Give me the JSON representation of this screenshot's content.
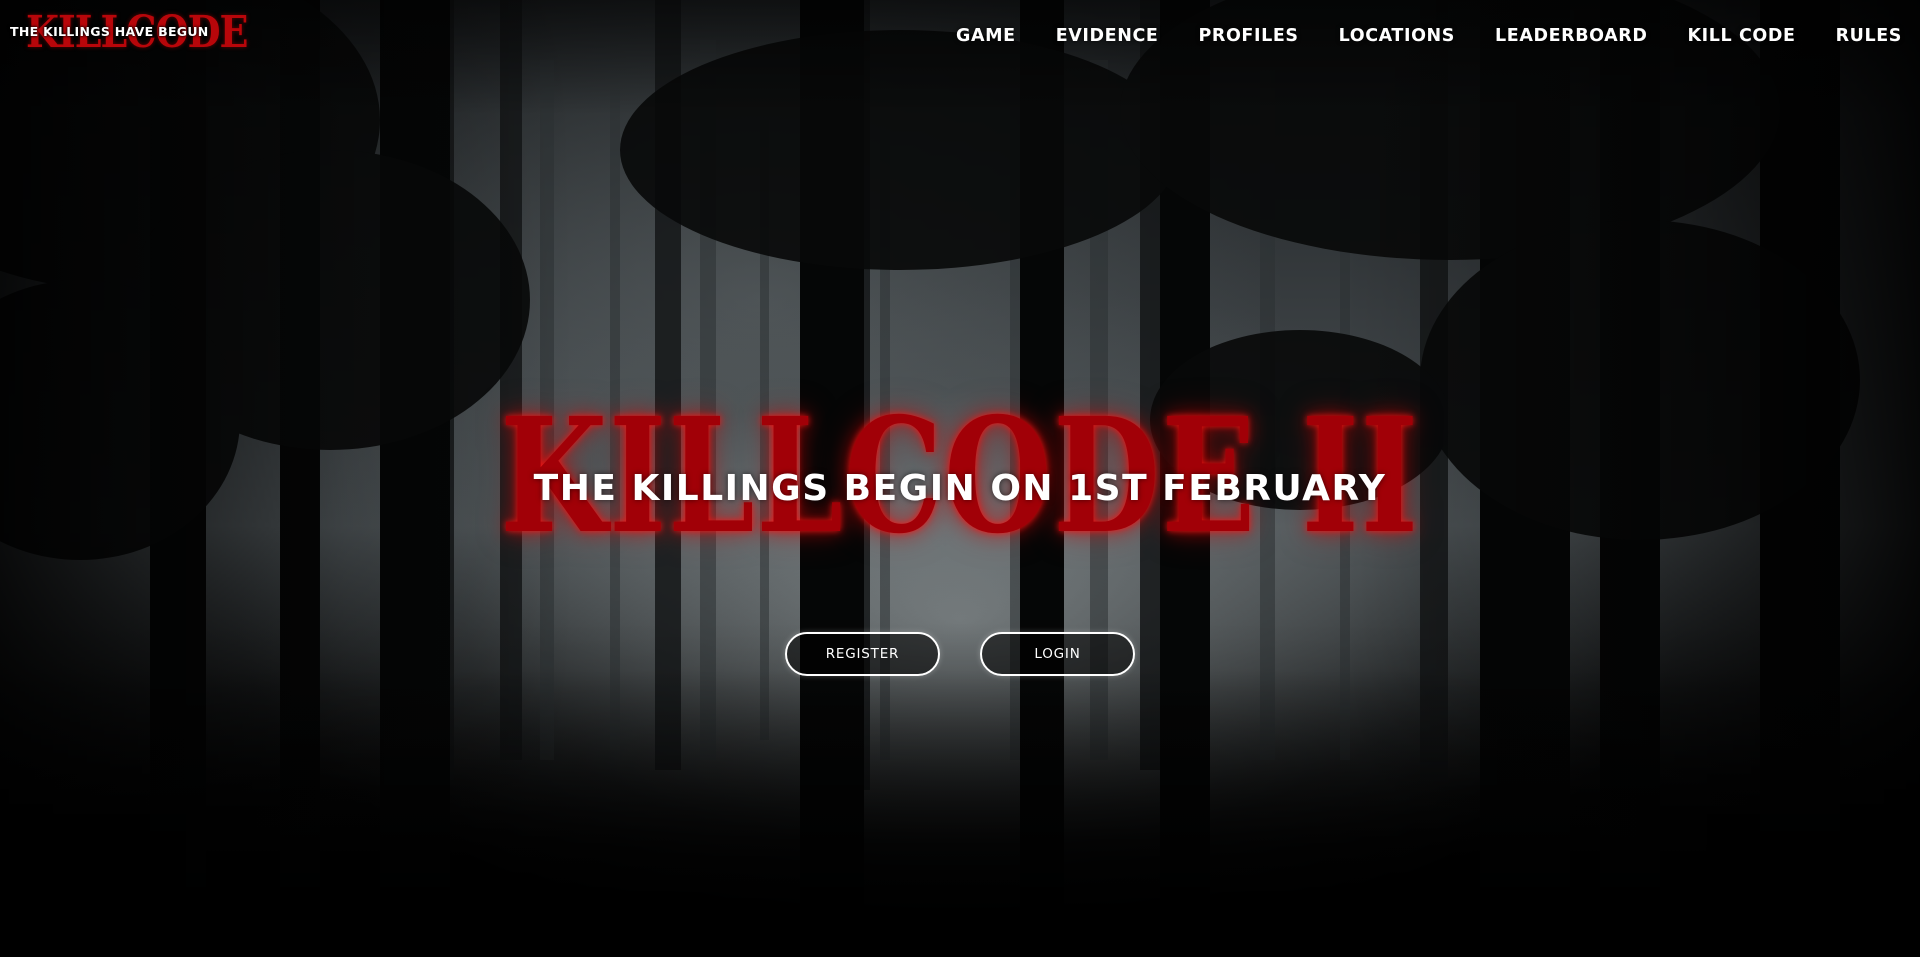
{
  "header": {
    "logo_text": "KILLCODE",
    "tagline": "THE KILLINGS HAVE BEGUN",
    "nav": [
      {
        "label": "GAME"
      },
      {
        "label": "EVIDENCE"
      },
      {
        "label": "PROFILES"
      },
      {
        "label": "LOCATIONS"
      },
      {
        "label": "LEADERBOARD"
      },
      {
        "label": "KILL CODE"
      },
      {
        "label": "RULES"
      }
    ]
  },
  "hero": {
    "title": "KILLCODE II",
    "subtitle": "THE KILLINGS BEGIN ON 1ST FEBRUARY",
    "register_label": "REGISTER",
    "login_label": "LOGIN"
  },
  "colors": {
    "accent_red": "#a10007",
    "text": "#ffffff",
    "background": "#000000"
  }
}
